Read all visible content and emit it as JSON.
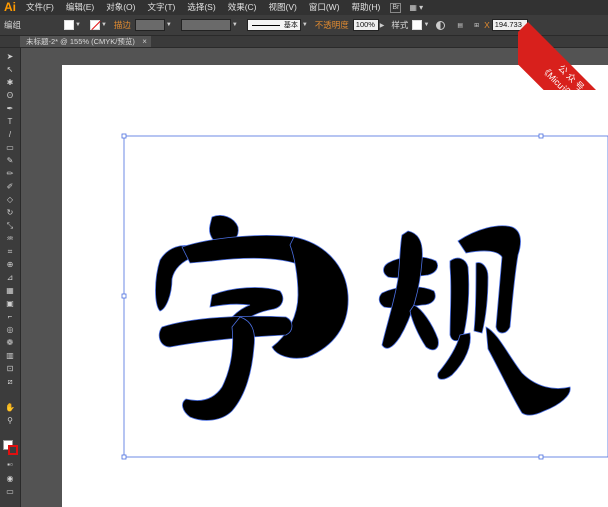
{
  "app": {
    "logo": "Ai"
  },
  "menu": [
    "文件(F)",
    "编辑(E)",
    "对象(O)",
    "文字(T)",
    "选择(S)",
    "效果(C)",
    "视图(V)",
    "窗口(W)",
    "帮助(H)"
  ],
  "control_bar": {
    "object_label": "编组",
    "stroke_label": "描边",
    "stroke_style": "基本",
    "opacity_label": "不透明度",
    "opacity_value": "100%",
    "style_label": "样式",
    "x_label": "X",
    "x_value": "194.733"
  },
  "tab": {
    "title": "未标题-2* @ 155% (CMYK/预览)",
    "close": "×"
  },
  "watermark": {
    "line1": "公 众 号",
    "line2": "《Micu设计》"
  },
  "colors": {
    "accent_orange": "#ff9a00",
    "selection_blue": "#4a6ee0",
    "watermark_red": "#d8201c"
  },
  "icons": [
    "selection-tool",
    "direct-selection-tool",
    "magic-wand-tool",
    "lasso-tool",
    "pen-tool",
    "type-tool",
    "line-tool",
    "rectangle-tool",
    "paintbrush-tool",
    "pencil-tool",
    "eraser-tool",
    "rotate-tool",
    "scale-tool",
    "warp-tool",
    "free-transform-tool",
    "shape-builder-tool",
    "perspective-grid-tool",
    "mesh-tool",
    "gradient-tool",
    "eyedropper-tool",
    "blend-tool",
    "symbol-sprayer-tool",
    "column-graph-tool",
    "artboard-tool",
    "slice-tool",
    "hand-tool",
    "zoom-tool"
  ]
}
